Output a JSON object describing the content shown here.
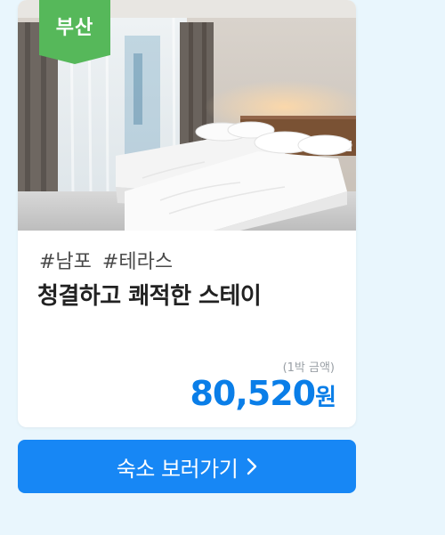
{
  "card": {
    "badge": "부산",
    "tags": [
      "#남포",
      "#테라스"
    ],
    "title": "청결하고 쾌적한 스테이",
    "price_note": "(1박 금액)",
    "price": "80,520",
    "price_unit": "원"
  },
  "cta": {
    "label": "숙소 보러가기"
  },
  "icons": {
    "cta_arrow": "chevron-right-icon",
    "photo": "hotel-room-photo"
  },
  "colors": {
    "background": "#e9f6fd",
    "badge": "#56b85a",
    "price": "#0a7ee8",
    "cta": "#1787f5"
  }
}
